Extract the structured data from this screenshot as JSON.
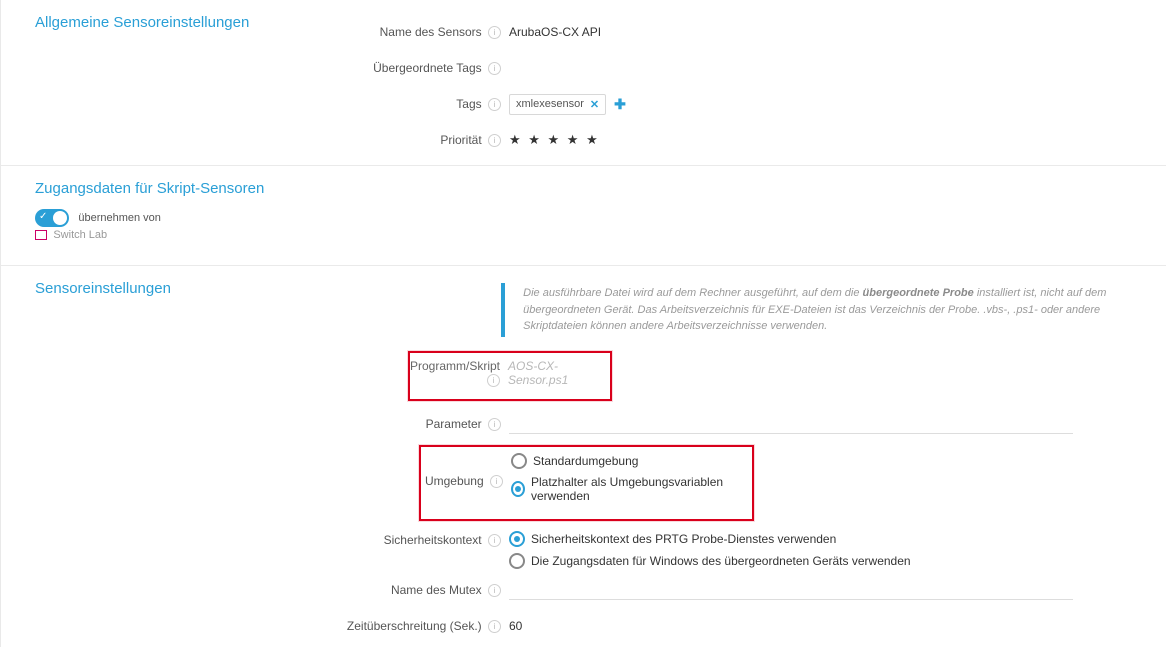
{
  "sections": {
    "general": {
      "title": "Allgemeine Sensoreinstellungen",
      "sensor_name_label": "Name des Sensors",
      "sensor_name_value": "ArubaOS-CX API",
      "parent_tags_label": "Übergeordnete Tags",
      "tags_label": "Tags",
      "tag_value": "xmlexesensor",
      "priority_label": "Priorität",
      "priority_value": 5
    },
    "credentials": {
      "title": "Zugangsdaten für Skript-Sensoren",
      "inherit_text": "übernehmen von",
      "inherit_from": "Switch Lab"
    },
    "settings": {
      "title": "Sensoreinstellungen",
      "info_note_pre": "Die ausführbare Datei wird auf dem Rechner ausgeführt, auf dem die ",
      "info_note_bold": "übergeordnete Probe",
      "info_note_post": " installiert ist, nicht auf dem übergeordneten Gerät. Das Arbeitsverzeichnis für EXE-Dateien ist das Verzeichnis der Probe. .vbs-, .ps1- oder andere Skriptdateien können andere Arbeitsverzeichnisse verwenden.",
      "script_label": "Programm/Skript",
      "script_value": "AOS-CX-Sensor.ps1",
      "parameter_label": "Parameter",
      "parameter_value": "",
      "env_label": "Umgebung",
      "env_opt_default": "Standardumgebung",
      "env_opt_placeholders": "Platzhalter als Umgebungsvariablen verwenden",
      "security_label": "Sicherheitskontext",
      "security_opt_probe": "Sicherheitskontext des PRTG Probe-Dienstes verwenden",
      "security_opt_windows": "Die Zugangsdaten für Windows des übergeordneten Geräts verwenden",
      "mutex_label": "Name des Mutex",
      "mutex_value": "",
      "timeout_label": "Zeitüberschreitung (Sek.)",
      "timeout_value": "60"
    }
  }
}
